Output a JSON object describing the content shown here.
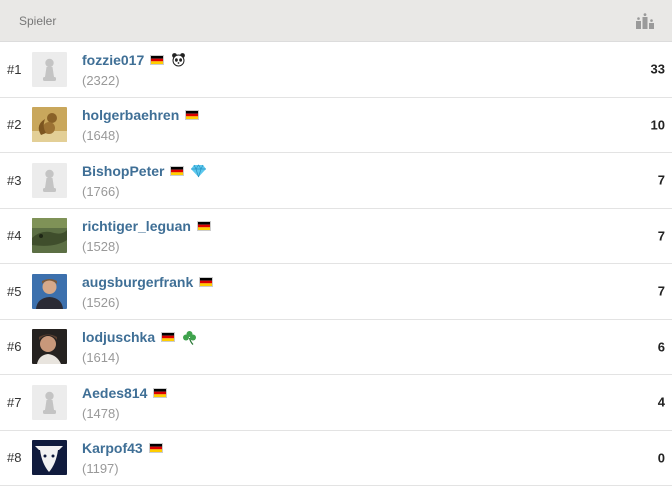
{
  "header": {
    "title": "Spieler",
    "icon": "podium-icon"
  },
  "players": [
    {
      "rank": "#1",
      "name": "fozzie017",
      "rating": "(2322)",
      "count": "33",
      "avatar": "pawn-placeholder",
      "flag": "de",
      "badge": "panda-icon"
    },
    {
      "rank": "#2",
      "name": "holgerbaehren",
      "rating": "(1648)",
      "count": "10",
      "avatar": "squirrel-photo",
      "flag": "de",
      "badge": ""
    },
    {
      "rank": "#3",
      "name": "BishopPeter",
      "rating": "(1766)",
      "count": "7",
      "avatar": "pawn-placeholder",
      "flag": "de",
      "badge": "diamond-icon"
    },
    {
      "rank": "#4",
      "name": "richtiger_leguan",
      "rating": "(1528)",
      "count": "7",
      "avatar": "iguana-photo",
      "flag": "de",
      "badge": ""
    },
    {
      "rank": "#5",
      "name": "augsburgerfrank",
      "rating": "(1526)",
      "count": "7",
      "avatar": "portrait-photo",
      "flag": "de",
      "badge": ""
    },
    {
      "rank": "#6",
      "name": "lodjuschka",
      "rating": "(1614)",
      "count": "6",
      "avatar": "portrait-photo-2",
      "flag": "de",
      "badge": "clover-icon"
    },
    {
      "rank": "#7",
      "name": "Aedes814",
      "rating": "(1478)",
      "count": "4",
      "avatar": "pawn-placeholder",
      "flag": "de",
      "badge": ""
    },
    {
      "rank": "#8",
      "name": "Karpof43",
      "rating": "(1197)",
      "count": "0",
      "avatar": "cartoon-photo",
      "flag": "de",
      "badge": ""
    }
  ]
}
